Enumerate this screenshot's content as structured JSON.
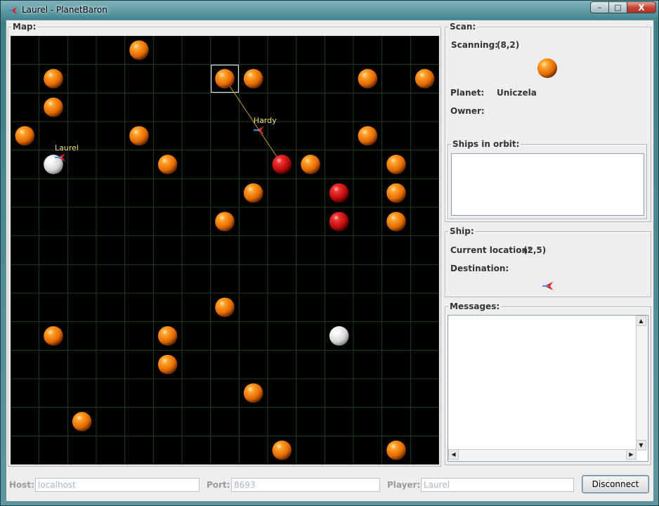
{
  "window": {
    "title": "Laurel - PlanetBaron",
    "controls": {
      "minimize": "–",
      "maximize": "□",
      "close": "X"
    }
  },
  "map": {
    "title": "Map:",
    "grid_size": 15,
    "colors": {
      "background": "#000000",
      "grid": "#1f3d1f",
      "neutral_planet": "#f28a10",
      "red_planet": "#d81a1a",
      "white_planet": "#f4f4f4",
      "fleet_label": "#f0e070",
      "selection": "#ffffff"
    },
    "planets": [
      {
        "x": 4,
        "y": 0,
        "type": "neutral"
      },
      {
        "x": 1,
        "y": 1,
        "type": "neutral"
      },
      {
        "x": 7,
        "y": 1,
        "type": "neutral"
      },
      {
        "x": 8,
        "y": 1,
        "type": "neutral"
      },
      {
        "x": 12,
        "y": 1,
        "type": "neutral"
      },
      {
        "x": 14,
        "y": 1,
        "type": "neutral"
      },
      {
        "x": 1,
        "y": 2,
        "type": "neutral"
      },
      {
        "x": 0,
        "y": 3,
        "type": "neutral"
      },
      {
        "x": 4,
        "y": 3,
        "type": "neutral"
      },
      {
        "x": 12,
        "y": 3,
        "type": "neutral"
      },
      {
        "x": 1,
        "y": 4,
        "type": "white"
      },
      {
        "x": 5,
        "y": 4,
        "type": "neutral"
      },
      {
        "x": 9,
        "y": 4,
        "type": "red"
      },
      {
        "x": 10,
        "y": 4,
        "type": "neutral"
      },
      {
        "x": 13,
        "y": 4,
        "type": "neutral"
      },
      {
        "x": 8,
        "y": 5,
        "type": "neutral"
      },
      {
        "x": 11,
        "y": 5,
        "type": "red"
      },
      {
        "x": 13,
        "y": 5,
        "type": "neutral"
      },
      {
        "x": 7,
        "y": 6,
        "type": "neutral"
      },
      {
        "x": 11,
        "y": 6,
        "type": "red"
      },
      {
        "x": 13,
        "y": 6,
        "type": "neutral"
      },
      {
        "x": 7,
        "y": 9,
        "type": "neutral"
      },
      {
        "x": 1,
        "y": 10,
        "type": "neutral"
      },
      {
        "x": 5,
        "y": 10,
        "type": "neutral"
      },
      {
        "x": 11,
        "y": 10,
        "type": "white"
      },
      {
        "x": 5,
        "y": 11,
        "type": "neutral"
      },
      {
        "x": 8,
        "y": 12,
        "type": "neutral"
      },
      {
        "x": 2,
        "y": 13,
        "type": "neutral"
      },
      {
        "x": 9,
        "y": 14,
        "type": "neutral"
      },
      {
        "x": 13,
        "y": 14,
        "type": "neutral"
      }
    ],
    "selected_cell": {
      "x": 7,
      "y": 1
    },
    "fleets": [
      {
        "name": "Hardy",
        "from": {
          "x": 9,
          "y": 4
        },
        "to": {
          "x": 7,
          "y": 1
        },
        "progress": 0.4
      },
      {
        "name": "Laurel",
        "from": {
          "x": 1,
          "y": 4
        },
        "to": {
          "x": 1,
          "y": 4
        },
        "progress": 0
      }
    ]
  },
  "scan": {
    "title": "Scan:",
    "scanning_label": "Scanning:",
    "scanning_value": "(8,2)",
    "planet_label": "Planet:",
    "planet_value": "Uniczela",
    "owner_label": "Owner:",
    "owner_value": "",
    "ships_in_orbit_title": "Ships in orbit:"
  },
  "ship": {
    "title": "Ship:",
    "current_location_label": "Current location:",
    "current_location_value": "(2,5)",
    "destination_label": "Destination:",
    "destination_value": ""
  },
  "messages": {
    "title": "Messages:",
    "content": ""
  },
  "connection": {
    "host_label": "Host:",
    "host_value": "localhost",
    "port_label": "Port:",
    "port_value": "8693",
    "player_label": "Player:",
    "player_value": "Laurel",
    "disconnect_label": "Disconnect"
  }
}
